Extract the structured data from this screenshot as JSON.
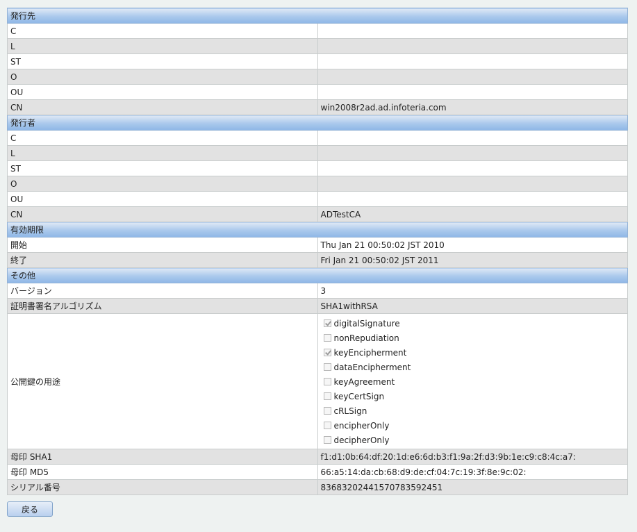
{
  "sections": {
    "subject": "発行先",
    "issuer": "発行者",
    "validity": "有効期限",
    "other": "その他"
  },
  "subject": {
    "C": {
      "label": "C",
      "value": ""
    },
    "L": {
      "label": "L",
      "value": ""
    },
    "ST": {
      "label": "ST",
      "value": ""
    },
    "O": {
      "label": "O",
      "value": ""
    },
    "OU": {
      "label": "OU",
      "value": ""
    },
    "CN": {
      "label": "CN",
      "value": "win2008r2ad.ad.infoteria.com"
    }
  },
  "issuer": {
    "C": {
      "label": "C",
      "value": ""
    },
    "L": {
      "label": "L",
      "value": ""
    },
    "ST": {
      "label": "ST",
      "value": ""
    },
    "O": {
      "label": "O",
      "value": ""
    },
    "OU": {
      "label": "OU",
      "value": ""
    },
    "CN": {
      "label": "CN",
      "value": "ADTestCA"
    }
  },
  "validity": {
    "start": {
      "label": "開始",
      "value": "Thu Jan 21 00:50:02 JST 2010"
    },
    "end": {
      "label": "終了",
      "value": "Fri Jan 21 00:50:02 JST 2011"
    }
  },
  "other": {
    "version": {
      "label": "バージョン",
      "value": "3"
    },
    "algorithm": {
      "label": "証明書署名アルゴリズム",
      "value": "SHA1withRSA"
    },
    "key_usage": {
      "label": "公開鍵の用途",
      "items": [
        {
          "label": "digitalSignature",
          "checked": true
        },
        {
          "label": "nonRepudiation",
          "checked": false
        },
        {
          "label": "keyEncipherment",
          "checked": true
        },
        {
          "label": "dataEncipherment",
          "checked": false
        },
        {
          "label": "keyAgreement",
          "checked": false
        },
        {
          "label": "keyCertSign",
          "checked": false
        },
        {
          "label": "cRLSign",
          "checked": false
        },
        {
          "label": "encipherOnly",
          "checked": false
        },
        {
          "label": "decipherOnly",
          "checked": false
        }
      ]
    },
    "sha1": {
      "label": "母印 SHA1",
      "value": "f1:d1:0b:64:df:20:1d:e6:6d:b3:f1:9a:2f:d3:9b:1e:c9:c8:4c:a7:"
    },
    "md5": {
      "label": "母印 MD5",
      "value": "66:a5:14:da:cb:68:d9:de:cf:04:7c:19:3f:8e:9c:02:"
    },
    "serial": {
      "label": "シリアル番号",
      "value": "8368320244157078359245​1"
    }
  },
  "back_button": "戻る"
}
